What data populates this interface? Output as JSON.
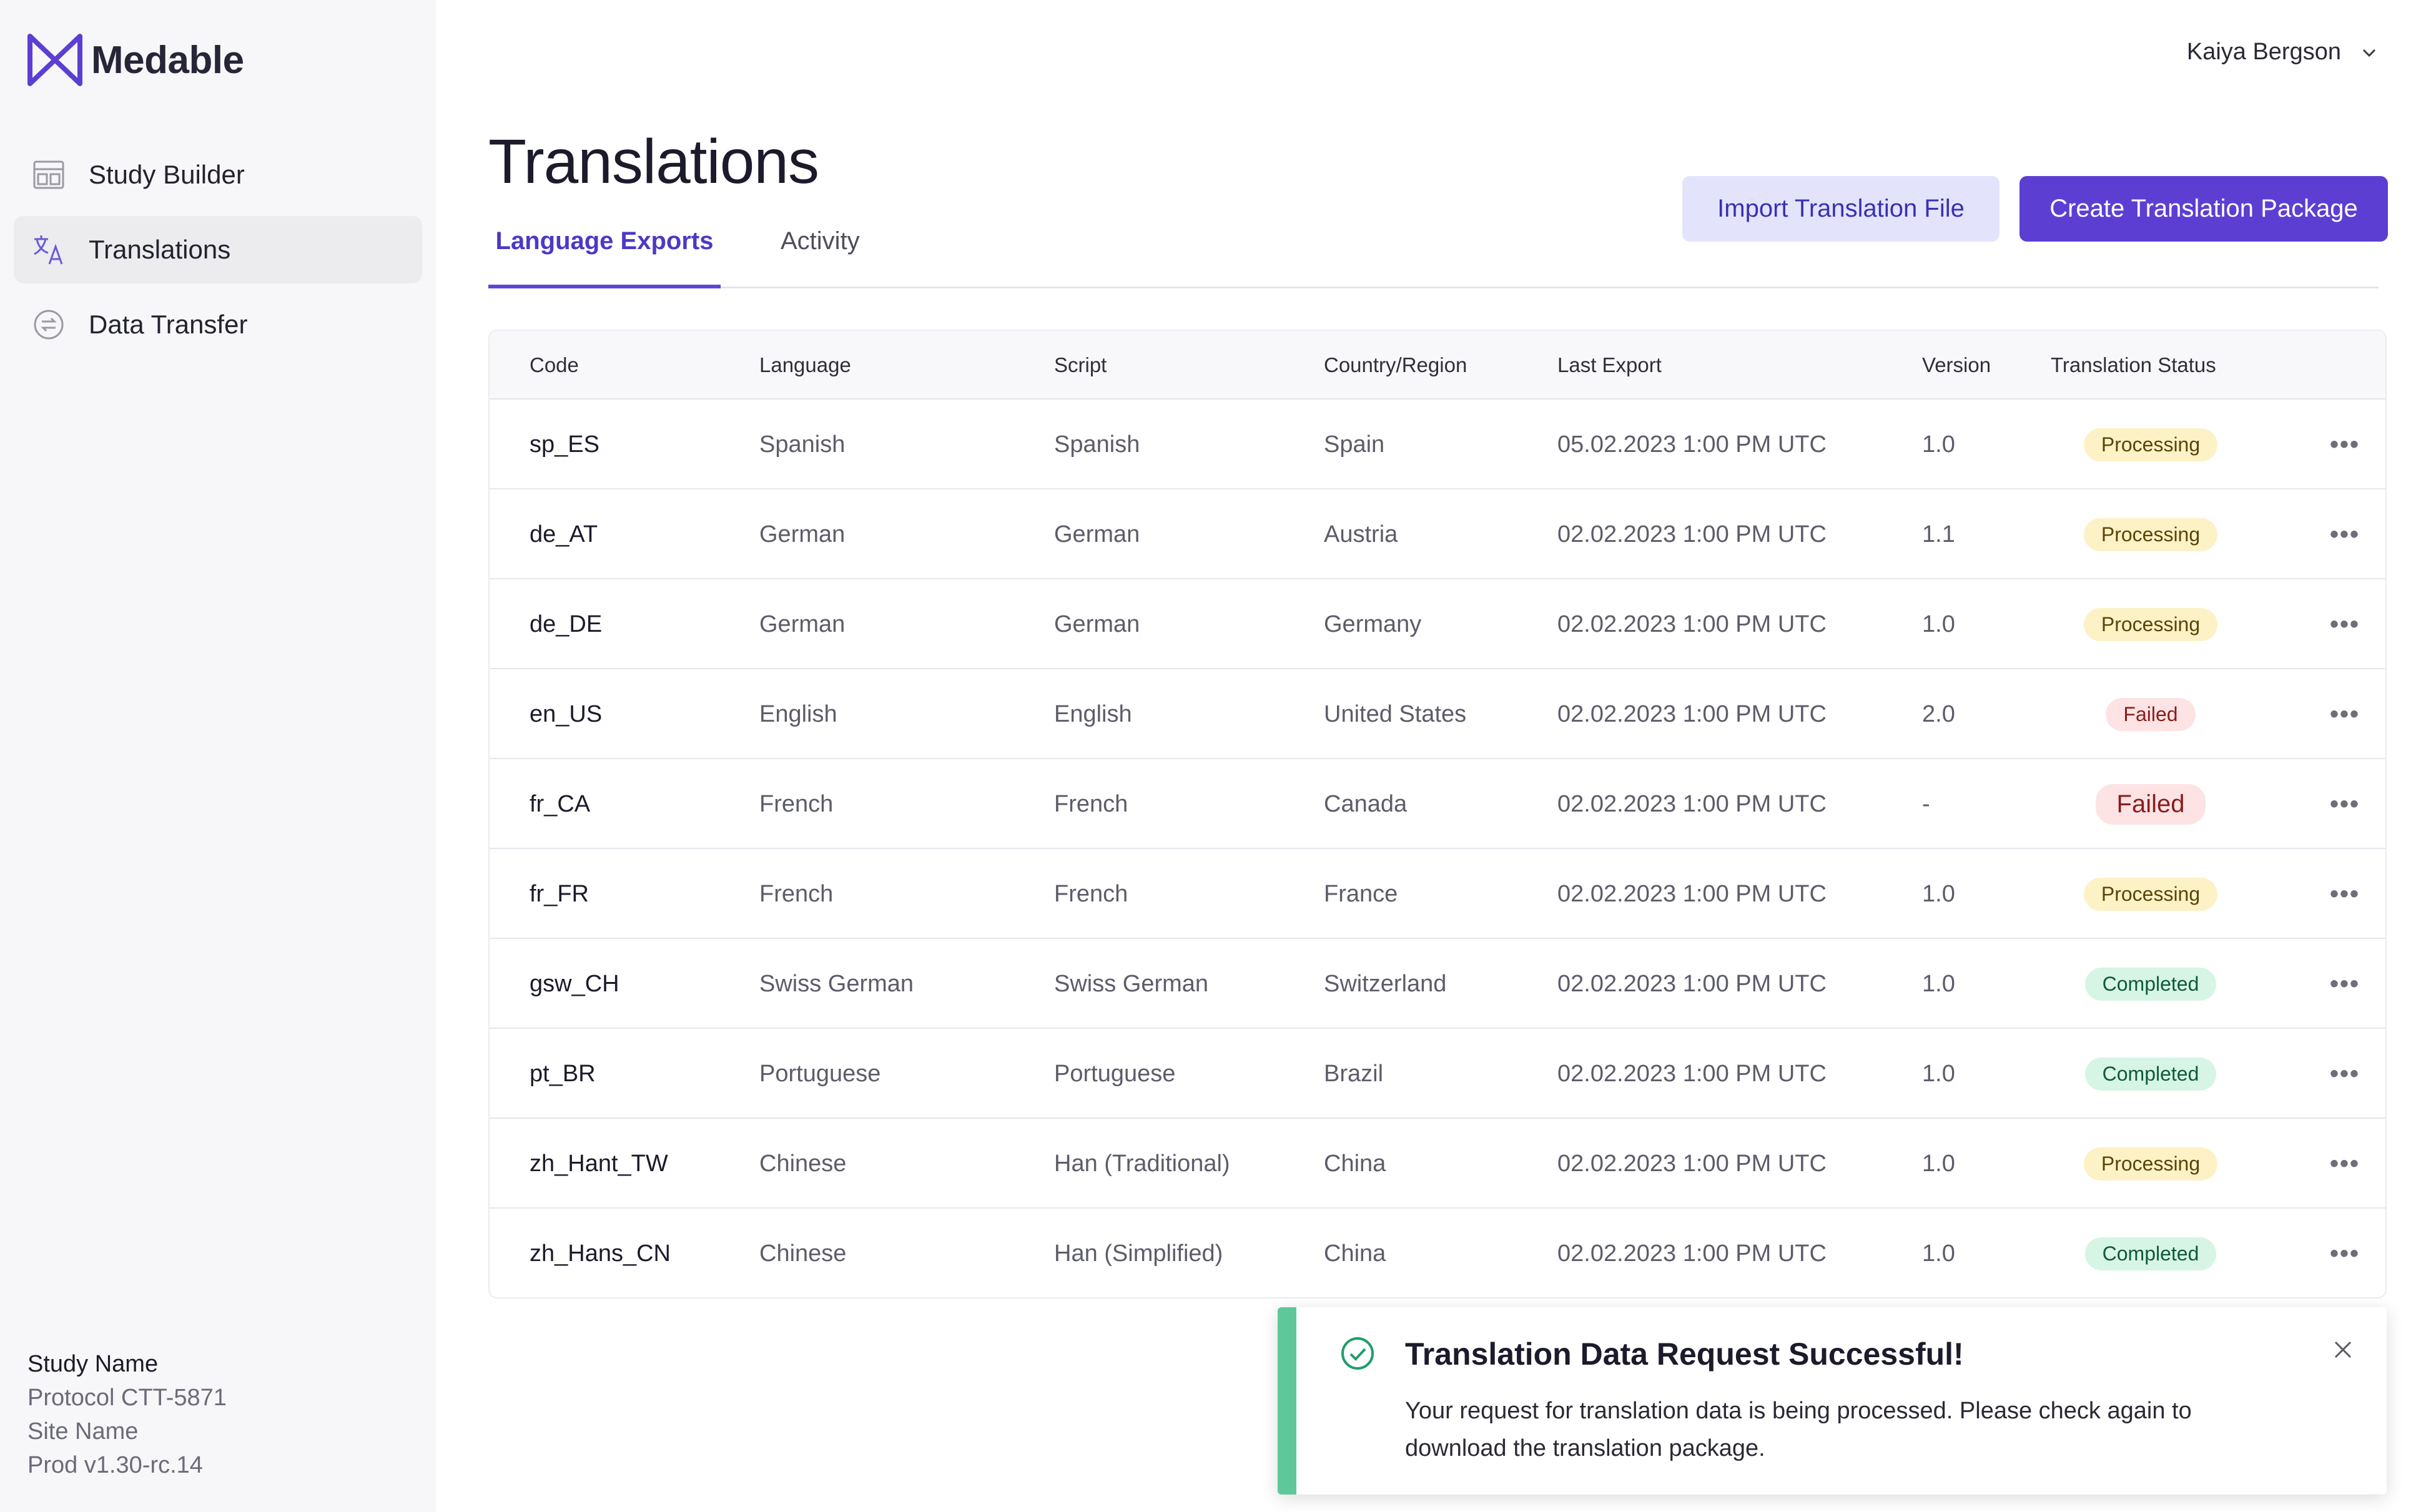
{
  "brand": {
    "name": "Medable",
    "accent": "#5c3fd2"
  },
  "sidebar": {
    "items": [
      {
        "label": "Study Builder",
        "icon": "layout-icon"
      },
      {
        "label": "Translations",
        "icon": "translate-icon"
      },
      {
        "label": "Data Transfer",
        "icon": "transfer-icon"
      }
    ],
    "study": {
      "name": "Study Name",
      "protocol": "Protocol CTT-5871",
      "site": "Site Name",
      "version": "Prod v1.30-rc.14"
    }
  },
  "header": {
    "user_name": "Kaiya Bergson"
  },
  "page": {
    "title": "Translations",
    "tabs": [
      "Language Exports",
      "Activity"
    ],
    "import_label": "Import Translation File",
    "create_label": "Create Translation Package"
  },
  "table": {
    "columns": [
      "Code",
      "Language",
      "Script",
      "Country/Region",
      "Last Export",
      "Version",
      "Translation Status"
    ],
    "rows": [
      {
        "code": "sp_ES",
        "language": "Spanish",
        "script": "Spanish",
        "country": "Spain",
        "last_export": "05.02.2023 1:00 PM UTC",
        "version": "1.0",
        "status": "Processing"
      },
      {
        "code": "de_AT",
        "language": "German",
        "script": "German",
        "country": "Austria",
        "last_export": "02.02.2023 1:00 PM UTC",
        "version": "1.1",
        "status": "Processing"
      },
      {
        "code": "de_DE",
        "language": "German",
        "script": "German",
        "country": "Germany",
        "last_export": "02.02.2023 1:00 PM UTC",
        "version": "1.0",
        "status": "Processing"
      },
      {
        "code": "en_US",
        "language": "English",
        "script": "English",
        "country": "United States",
        "last_export": "02.02.2023 1:00 PM UTC",
        "version": "2.0",
        "status": "Failed"
      },
      {
        "code": "fr_CA",
        "language": "French",
        "script": "French",
        "country": "Canada",
        "last_export": "02.02.2023 1:00 PM UTC",
        "version": "-",
        "status": "Failed"
      },
      {
        "code": "fr_FR",
        "language": "French",
        "script": "French",
        "country": "France",
        "last_export": "02.02.2023 1:00 PM UTC",
        "version": "1.0",
        "status": "Processing"
      },
      {
        "code": "gsw_CH",
        "language": "Swiss German",
        "script": "Swiss German",
        "country": "Switzerland",
        "last_export": "02.02.2023 1:00 PM UTC",
        "version": "1.0",
        "status": "Completed"
      },
      {
        "code": "pt_BR",
        "language": "Portuguese",
        "script": "Portuguese",
        "country": "Brazil",
        "last_export": "02.02.2023 1:00 PM UTC",
        "version": "1.0",
        "status": "Completed"
      },
      {
        "code": "zh_Hant_TW",
        "language": "Chinese",
        "script": "Han (Traditional)",
        "country": "China",
        "last_export": "02.02.2023 1:00 PM UTC",
        "version": "1.0",
        "status": "Processing"
      },
      {
        "code": "zh_Hans_CN",
        "language": "Chinese",
        "script": "Han (Simplified)",
        "country": "China",
        "last_export": "02.02.2023 1:00 PM UTC",
        "version": "1.0",
        "status": "Completed"
      }
    ]
  },
  "toast": {
    "title": "Translation Data Request Successful!",
    "body": "Your request for translation data is being processed. Please check again to download the translation package.",
    "accent": "#5fc89a"
  },
  "status_colors": {
    "processing": "#fdf1c6",
    "failed": "#fde3e3",
    "completed": "#d7f5e4"
  }
}
